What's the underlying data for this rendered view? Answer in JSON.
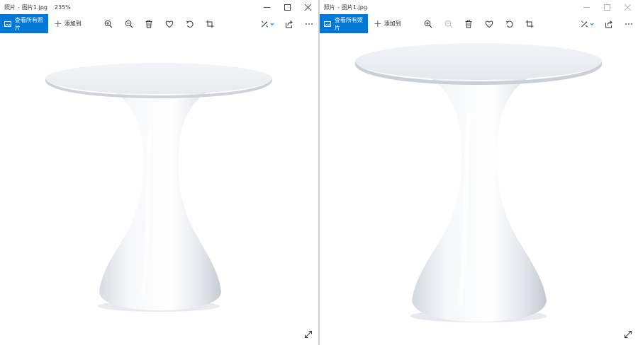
{
  "windows": [
    {
      "title": {
        "app": "照片",
        "separator": "-",
        "file": "图片1.jpg",
        "zoom": "235%"
      },
      "toolbar": {
        "view_all_label": "查看所有照片",
        "add_to_label": "添加到"
      }
    },
    {
      "title": {
        "app": "照片",
        "separator": "-",
        "file": "图片1.jpg",
        "zoom": ""
      },
      "toolbar": {
        "view_all_label": "查看所有照片",
        "add_to_label": "添加到"
      }
    }
  ],
  "toolbar_icons": [
    "zoom-in-icon",
    "zoom-out-icon",
    "delete-icon",
    "favorite-icon",
    "rotate-icon",
    "crop-icon",
    "edit-icon",
    "share-icon",
    "more-icon"
  ],
  "colors": {
    "accent": "#0078d7",
    "table": "#f2f3f6",
    "table_shadow": "#c9ccd3"
  }
}
